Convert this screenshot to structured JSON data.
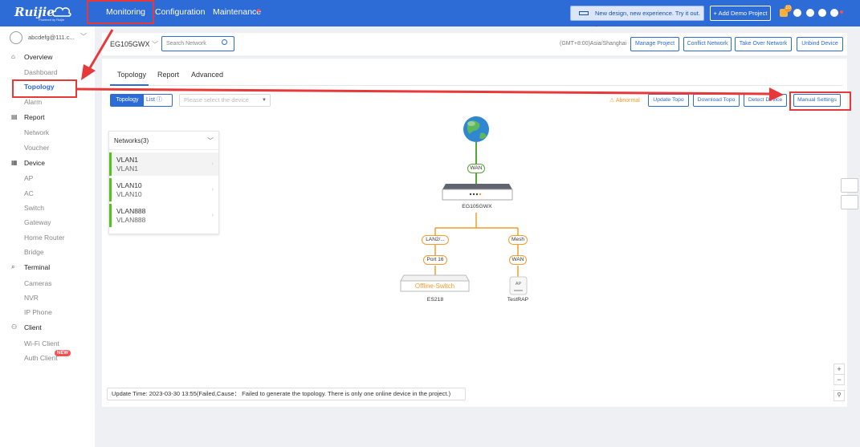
{
  "topbar": {
    "logo_text": "Ruijie",
    "logo_tag": "Powered by Ruijie",
    "nav": [
      "Monitoring",
      "Configuration",
      "Maintenance"
    ],
    "banner": "New design, new experience. Try it out.  >",
    "demo_project": "+ Add Demo Project",
    "message_count": "10"
  },
  "sidebar": {
    "user": "abcdefg@111.c...",
    "sections": [
      {
        "label": "Overview",
        "icon": "home-icon",
        "items": [
          "Dashboard",
          "Topology",
          "Alarm"
        ]
      },
      {
        "label": "Report",
        "icon": "report-icon",
        "items": [
          "Network",
          "Voucher"
        ]
      },
      {
        "label": "Device",
        "icon": "device-icon",
        "items": [
          "AP",
          "AC",
          "Switch",
          "Gateway",
          "Home Router",
          "Bridge"
        ]
      },
      {
        "label": "Terminal",
        "icon": "terminal-icon",
        "items": [
          "Cameras",
          "NVR",
          "IP Phone"
        ]
      },
      {
        "label": "Client",
        "icon": "client-icon",
        "items": [
          "Wi-Fi Client",
          "Auth Client"
        ]
      }
    ],
    "new_badge": "NEW",
    "active_item": "Topology"
  },
  "header": {
    "device": "EG105GWX",
    "search_placeholder": "Search Network",
    "timezone": "(GMT+8:00)Asia/Shanghai",
    "buttons": [
      "Manage Project",
      "Conflict Network",
      "Take Over Network",
      "Unbind Device"
    ]
  },
  "tabs": [
    "Topology",
    "Report",
    "Advanced"
  ],
  "toolbar": {
    "view_topology": "Topology",
    "view_list": "List ⓘ",
    "device_placeholder": "Please select the device",
    "abnormal": "⚠ Abnormal",
    "buttons": [
      "Update Topo",
      "Download Topo",
      "Detect Device",
      "Manual Settings"
    ]
  },
  "networks": {
    "title": "Networks(3)",
    "items": [
      {
        "name": "VLAN1",
        "desc": "VLAN1"
      },
      {
        "name": "VLAN10",
        "desc": "VLAN10"
      },
      {
        "name": "VLAN888",
        "desc": "VLAN888"
      }
    ]
  },
  "topology": {
    "wan_label": "WAN",
    "gateway_name": "EG105GWX",
    "left_uplink": "LAN2/...",
    "left_port": "Port 16",
    "right_uplink": "Mesh",
    "right_port": "WAN",
    "switch_status": "Offline-Switch",
    "switch_name": "ES218",
    "ap_label": "AP",
    "ap_name": "TestRAP"
  },
  "status": {
    "update_time": "Update Time: 2023-03-30 13:55(Failed,Cause： Failed to generate the topology. There is only one online device in the project.)"
  },
  "colors": {
    "brand": "#2d6bd6",
    "highlight": "#e8393a",
    "online": "#52a830",
    "offline": "#f39c2b"
  }
}
